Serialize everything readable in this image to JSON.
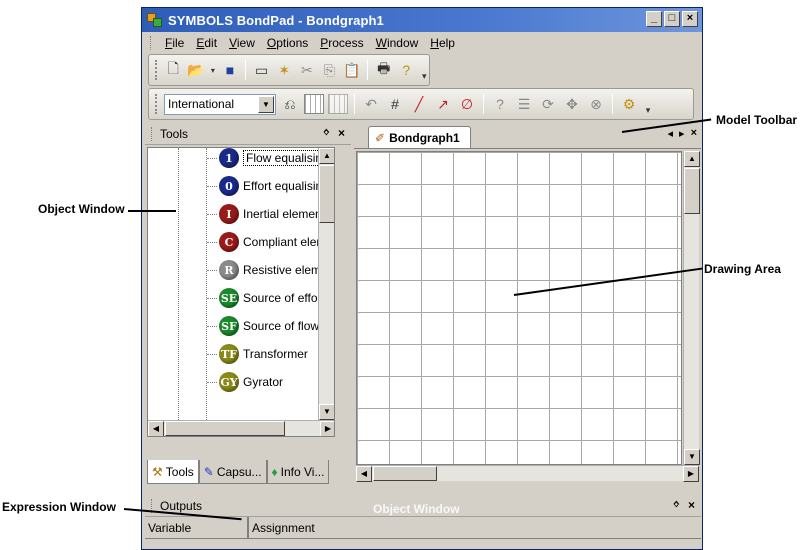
{
  "window": {
    "title": "SYMBOLS BondPad - Bondgraph1",
    "controls": [
      "_",
      "□",
      "×"
    ]
  },
  "menu": [
    "File",
    "Edit",
    "View",
    "Options",
    "Process",
    "Window",
    "Help"
  ],
  "model_toolbar": {
    "combo_value": "International"
  },
  "tools_pane": {
    "title": "Tools",
    "pin": "ᛜ",
    "close": "×",
    "items": [
      {
        "badge": "1",
        "label": "Flow equalising ju",
        "color": "#1a2a8a",
        "selected": true
      },
      {
        "badge": "0",
        "label": "Effort equalising ju",
        "color": "#1a2a8a"
      },
      {
        "badge": "I",
        "label": "Inertial element",
        "color": "#9a1a1a"
      },
      {
        "badge": "C",
        "label": "Compliant element",
        "color": "#9a1a1a"
      },
      {
        "badge": "R",
        "label": "Resistive element",
        "color": "#8a8a8a"
      },
      {
        "badge": "SE",
        "label": "Source of effort",
        "color": "#1a8a2a"
      },
      {
        "badge": "SF",
        "label": "Source of flow",
        "color": "#1a8a2a"
      },
      {
        "badge": "TF",
        "label": "Transformer",
        "color": "#8a8a1a"
      },
      {
        "badge": "GY",
        "label": "Gyrator",
        "color": "#8a8a1a"
      }
    ],
    "tabs": [
      "Tools",
      "Capsu...",
      "Info Vi..."
    ]
  },
  "document": {
    "tab": "Bondgraph1",
    "controls": [
      "◂",
      "▸",
      "×"
    ]
  },
  "outputs": {
    "title": "Outputs",
    "pin": "ᛜ",
    "close": "×",
    "columns": [
      "Variable",
      "Assignment"
    ],
    "ghost_label": "Object Window"
  },
  "callouts": {
    "model_toolbar": "Model Toolbar",
    "object_window": "Object Window",
    "drawing_area": "Drawing Area",
    "expression_window": "Expression Window"
  }
}
